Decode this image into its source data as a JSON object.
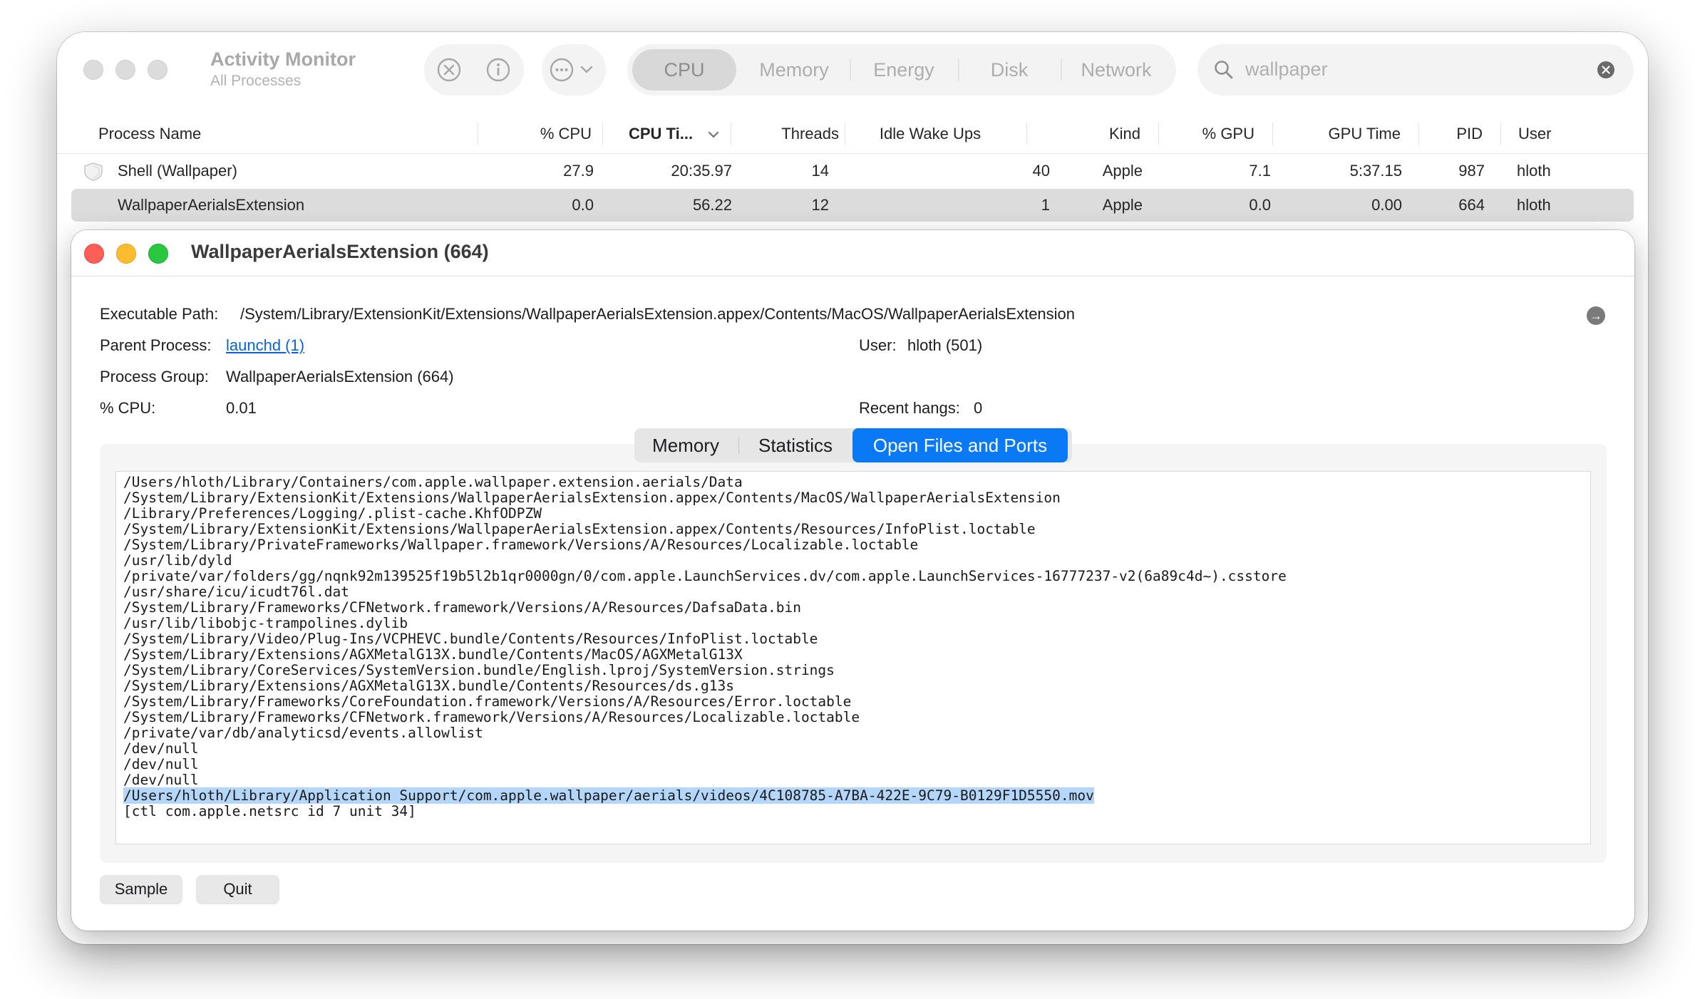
{
  "app": {
    "title": "Activity Monitor",
    "subtitle": "All Processes"
  },
  "toolbar": {
    "tabs": [
      {
        "label": "CPU",
        "active": true
      },
      {
        "label": "Memory"
      },
      {
        "label": "Energy"
      },
      {
        "label": "Disk"
      },
      {
        "label": "Network"
      }
    ],
    "search": {
      "value": "wallpaper"
    }
  },
  "table": {
    "columns": [
      "Process Name",
      "% CPU",
      "CPU Ti...",
      "Threads",
      "Idle Wake Ups",
      "Kind",
      "% GPU",
      "GPU Time",
      "PID",
      "User"
    ],
    "rows": [
      {
        "name": "Shell (Wallpaper)",
        "cpu": "27.9",
        "cpu_time": "20:35.97",
        "threads": "14",
        "idle_wake_ups": "40",
        "kind": "Apple",
        "gpu": "7.1",
        "gpu_time": "5:37.15",
        "pid": "987",
        "user": "hloth"
      },
      {
        "name": "WallpaperAerialsExtension",
        "cpu": "0.0",
        "cpu_time": "56.22",
        "threads": "12",
        "idle_wake_ups": "1",
        "kind": "Apple",
        "gpu": "0.0",
        "gpu_time": "0.00",
        "pid": "664",
        "user": "hloth",
        "selected": true
      }
    ]
  },
  "info": {
    "title": "WallpaperAerialsExtension (664)",
    "executable_path_label": "Executable Path:",
    "executable_path": "/System/Library/ExtensionKit/Extensions/WallpaperAerialsExtension.appex/Contents/MacOS/WallpaperAerialsExtension",
    "parent_process_label": "Parent Process:",
    "parent_process": "launchd (1)",
    "user_label": "User:",
    "user": "hloth (501)",
    "process_group_label": "Process Group:",
    "process_group": "WallpaperAerialsExtension (664)",
    "cpu_label": "% CPU:",
    "cpu": "0.01",
    "recent_hangs_label": "Recent hangs:",
    "recent_hangs": "0",
    "tabs": [
      {
        "label": "Memory"
      },
      {
        "label": "Statistics"
      },
      {
        "label": "Open Files and Ports",
        "active": true
      }
    ],
    "files": [
      "/Users/hloth/Library/Containers/com.apple.wallpaper.extension.aerials/Data",
      "/System/Library/ExtensionKit/Extensions/WallpaperAerialsExtension.appex/Contents/MacOS/WallpaperAerialsExtension",
      "/Library/Preferences/Logging/.plist-cache.KhfODPZW",
      "/System/Library/ExtensionKit/Extensions/WallpaperAerialsExtension.appex/Contents/Resources/InfoPlist.loctable",
      "/System/Library/PrivateFrameworks/Wallpaper.framework/Versions/A/Resources/Localizable.loctable",
      "/usr/lib/dyld",
      "/private/var/folders/gg/nqnk92m139525f19b5l2b1qr0000gn/0/com.apple.LaunchServices.dv/com.apple.LaunchServices-16777237-v2(6a89c4d~).csstore",
      "/usr/share/icu/icudt76l.dat",
      "/System/Library/Frameworks/CFNetwork.framework/Versions/A/Resources/DafsaData.bin",
      "/usr/lib/libobjc-trampolines.dylib",
      "/System/Library/Video/Plug-Ins/VCPHEVC.bundle/Contents/Resources/InfoPlist.loctable",
      "/System/Library/Extensions/AGXMetalG13X.bundle/Contents/MacOS/AGXMetalG13X",
      "/System/Library/CoreServices/SystemVersion.bundle/English.lproj/SystemVersion.strings",
      "/System/Library/Extensions/AGXMetalG13X.bundle/Contents/Resources/ds.g13s",
      "/System/Library/Frameworks/CoreFoundation.framework/Versions/A/Resources/Error.loctable",
      "/System/Library/Frameworks/CFNetwork.framework/Versions/A/Resources/Localizable.loctable",
      "/private/var/db/analyticsd/events.allowlist",
      "/dev/null",
      "/dev/null",
      "/dev/null",
      "/Users/hloth/Library/Application Support/com.apple.wallpaper/aerials/videos/4C108785-A7BA-422E-9C79-B0129F1D5550.mov",
      "[ctl com.apple.netsrc id 7 unit 34]"
    ],
    "highlighted_file_index": 20,
    "buttons": {
      "sample": "Sample",
      "quit": "Quit"
    }
  },
  "colors": {
    "accent": "#0a79f5",
    "link": "#0a64d6",
    "selection": "#b3d6fa",
    "close": "#ff5f57",
    "minimize": "#febc2e",
    "zoom": "#28c840"
  },
  "icons": [
    "stop-process-icon",
    "info-icon",
    "more-actions-icon",
    "chevron-down-icon",
    "search-icon",
    "clear-search-icon",
    "shield-icon",
    "go-arrow-icon"
  ]
}
